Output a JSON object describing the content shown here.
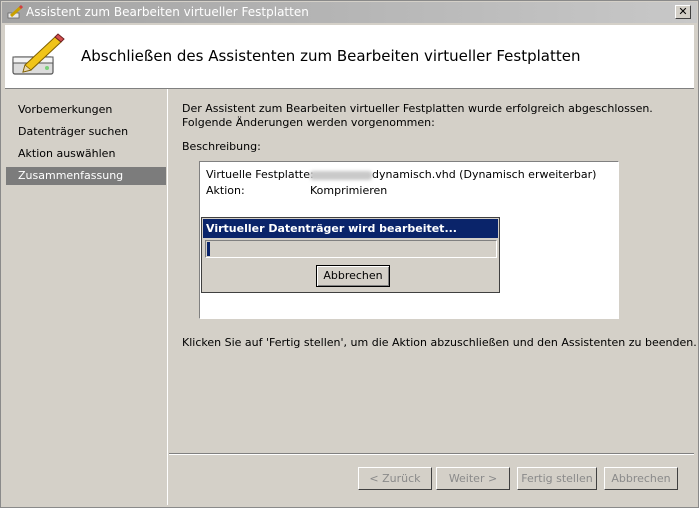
{
  "window": {
    "title": "Assistent zum Bearbeiten virtueller Festplatten",
    "close_glyph": "✕"
  },
  "header": {
    "heading": "Abschließen des Assistenten zum Bearbeiten virtueller Festplatten"
  },
  "nav": {
    "items": [
      {
        "label": "Vorbemerkungen",
        "selected": false
      },
      {
        "label": "Datenträger suchen",
        "selected": false
      },
      {
        "label": "Aktion auswählen",
        "selected": false
      },
      {
        "label": "Zusammenfassung",
        "selected": true
      }
    ]
  },
  "content": {
    "intro": "Der Assistent zum Bearbeiten virtueller Festplatten wurde erfolgreich abgeschlossen. Folgende Änderungen werden vorgenommen:",
    "description_label": "Beschreibung:",
    "summary": {
      "disk_key": "Virtuelle Festplatte:",
      "disk_value": "dynamisch.vhd (Dynamisch erweiterbar)",
      "action_key": "Aktion:",
      "action_value": "Komprimieren"
    },
    "finish_hint": "Klicken Sie auf 'Fertig stellen', um die Aktion abzuschließen und den Assistenten zu beenden."
  },
  "progress_dialog": {
    "title": "Virtueller Datenträger wird bearbeitet...",
    "progress_fraction": 0.01,
    "cancel_label": "Abbrechen"
  },
  "buttons": {
    "back": "< Zurück",
    "next": "Weiter >",
    "finish": "Fertig stellen",
    "cancel": "Abbrechen"
  },
  "colors": {
    "dialog_title_bg": "#0a246a",
    "selected_nav_bg": "#7c7c7c",
    "window_bg": "#d4d0c8"
  }
}
